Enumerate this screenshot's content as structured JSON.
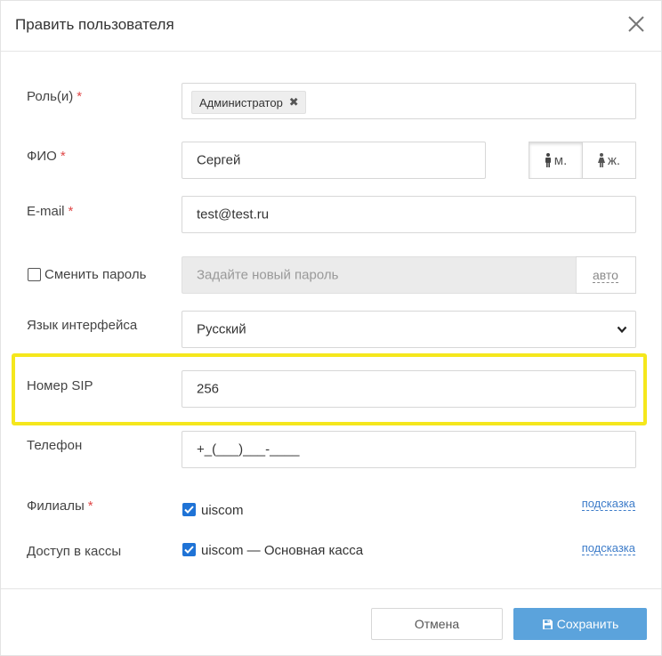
{
  "dialog": {
    "title": "Править пользователя"
  },
  "form": {
    "roles": {
      "label": "Роль(и)",
      "required_mark": "*",
      "tags": [
        "Администратор"
      ],
      "remove_glyph": "✖"
    },
    "fio": {
      "label": "ФИО",
      "required_mark": "*",
      "value": "Сергей"
    },
    "gender": {
      "male_label": "м.",
      "female_label": "ж.",
      "selected": "male"
    },
    "email": {
      "label": "E-mail",
      "required_mark": "*",
      "value": "test@test.ru"
    },
    "password": {
      "checkbox_label": "Сменить пароль",
      "checked": false,
      "placeholder": "Задайте новый пароль",
      "auto_label": "авто"
    },
    "language": {
      "label": "Язык интерфейса",
      "value": "Русский"
    },
    "sip": {
      "label": "Номер SIP",
      "value": "256"
    },
    "phone": {
      "label": "Телефон",
      "value": "+_(___)___-____"
    },
    "branches": {
      "label": "Филиалы",
      "required_mark": "*",
      "option": "uiscom",
      "checked": true,
      "hint": "подсказка"
    },
    "cash_access": {
      "label": "Доступ в кассы",
      "option": "uiscom — Основная касса",
      "checked": true,
      "hint": "подсказка"
    }
  },
  "footer": {
    "cancel_label": "Отмена",
    "save_label": "Сохранить"
  },
  "colors": {
    "highlight": "#f5e71c",
    "primary_button": "#5ba3dc",
    "checkbox": "#1f73d6",
    "required": "#e04848",
    "hint_link": "#3d7cc9"
  },
  "icons": {
    "close": "close-icon",
    "male": "male-icon",
    "female": "female-icon",
    "dropdown": "chevron-down-icon",
    "save": "floppy-disk-icon",
    "checkmark": "checkmark-icon"
  }
}
